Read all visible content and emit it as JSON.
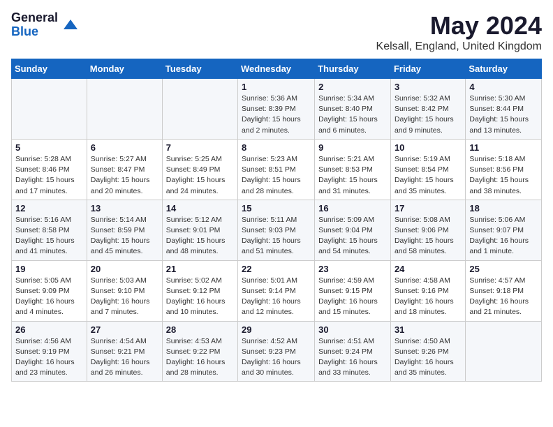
{
  "logo": {
    "general": "General",
    "blue": "Blue"
  },
  "header": {
    "month": "May 2024",
    "location": "Kelsall, England, United Kingdom"
  },
  "weekdays": [
    "Sunday",
    "Monday",
    "Tuesday",
    "Wednesday",
    "Thursday",
    "Friday",
    "Saturday"
  ],
  "weeks": [
    [
      {
        "day": "",
        "info": ""
      },
      {
        "day": "",
        "info": ""
      },
      {
        "day": "",
        "info": ""
      },
      {
        "day": "1",
        "info": "Sunrise: 5:36 AM\nSunset: 8:39 PM\nDaylight: 15 hours\nand 2 minutes."
      },
      {
        "day": "2",
        "info": "Sunrise: 5:34 AM\nSunset: 8:40 PM\nDaylight: 15 hours\nand 6 minutes."
      },
      {
        "day": "3",
        "info": "Sunrise: 5:32 AM\nSunset: 8:42 PM\nDaylight: 15 hours\nand 9 minutes."
      },
      {
        "day": "4",
        "info": "Sunrise: 5:30 AM\nSunset: 8:44 PM\nDaylight: 15 hours\nand 13 minutes."
      }
    ],
    [
      {
        "day": "5",
        "info": "Sunrise: 5:28 AM\nSunset: 8:46 PM\nDaylight: 15 hours\nand 17 minutes."
      },
      {
        "day": "6",
        "info": "Sunrise: 5:27 AM\nSunset: 8:47 PM\nDaylight: 15 hours\nand 20 minutes."
      },
      {
        "day": "7",
        "info": "Sunrise: 5:25 AM\nSunset: 8:49 PM\nDaylight: 15 hours\nand 24 minutes."
      },
      {
        "day": "8",
        "info": "Sunrise: 5:23 AM\nSunset: 8:51 PM\nDaylight: 15 hours\nand 28 minutes."
      },
      {
        "day": "9",
        "info": "Sunrise: 5:21 AM\nSunset: 8:53 PM\nDaylight: 15 hours\nand 31 minutes."
      },
      {
        "day": "10",
        "info": "Sunrise: 5:19 AM\nSunset: 8:54 PM\nDaylight: 15 hours\nand 35 minutes."
      },
      {
        "day": "11",
        "info": "Sunrise: 5:18 AM\nSunset: 8:56 PM\nDaylight: 15 hours\nand 38 minutes."
      }
    ],
    [
      {
        "day": "12",
        "info": "Sunrise: 5:16 AM\nSunset: 8:58 PM\nDaylight: 15 hours\nand 41 minutes."
      },
      {
        "day": "13",
        "info": "Sunrise: 5:14 AM\nSunset: 8:59 PM\nDaylight: 15 hours\nand 45 minutes."
      },
      {
        "day": "14",
        "info": "Sunrise: 5:12 AM\nSunset: 9:01 PM\nDaylight: 15 hours\nand 48 minutes."
      },
      {
        "day": "15",
        "info": "Sunrise: 5:11 AM\nSunset: 9:03 PM\nDaylight: 15 hours\nand 51 minutes."
      },
      {
        "day": "16",
        "info": "Sunrise: 5:09 AM\nSunset: 9:04 PM\nDaylight: 15 hours\nand 54 minutes."
      },
      {
        "day": "17",
        "info": "Sunrise: 5:08 AM\nSunset: 9:06 PM\nDaylight: 15 hours\nand 58 minutes."
      },
      {
        "day": "18",
        "info": "Sunrise: 5:06 AM\nSunset: 9:07 PM\nDaylight: 16 hours\nand 1 minute."
      }
    ],
    [
      {
        "day": "19",
        "info": "Sunrise: 5:05 AM\nSunset: 9:09 PM\nDaylight: 16 hours\nand 4 minutes."
      },
      {
        "day": "20",
        "info": "Sunrise: 5:03 AM\nSunset: 9:10 PM\nDaylight: 16 hours\nand 7 minutes."
      },
      {
        "day": "21",
        "info": "Sunrise: 5:02 AM\nSunset: 9:12 PM\nDaylight: 16 hours\nand 10 minutes."
      },
      {
        "day": "22",
        "info": "Sunrise: 5:01 AM\nSunset: 9:14 PM\nDaylight: 16 hours\nand 12 minutes."
      },
      {
        "day": "23",
        "info": "Sunrise: 4:59 AM\nSunset: 9:15 PM\nDaylight: 16 hours\nand 15 minutes."
      },
      {
        "day": "24",
        "info": "Sunrise: 4:58 AM\nSunset: 9:16 PM\nDaylight: 16 hours\nand 18 minutes."
      },
      {
        "day": "25",
        "info": "Sunrise: 4:57 AM\nSunset: 9:18 PM\nDaylight: 16 hours\nand 21 minutes."
      }
    ],
    [
      {
        "day": "26",
        "info": "Sunrise: 4:56 AM\nSunset: 9:19 PM\nDaylight: 16 hours\nand 23 minutes."
      },
      {
        "day": "27",
        "info": "Sunrise: 4:54 AM\nSunset: 9:21 PM\nDaylight: 16 hours\nand 26 minutes."
      },
      {
        "day": "28",
        "info": "Sunrise: 4:53 AM\nSunset: 9:22 PM\nDaylight: 16 hours\nand 28 minutes."
      },
      {
        "day": "29",
        "info": "Sunrise: 4:52 AM\nSunset: 9:23 PM\nDaylight: 16 hours\nand 30 minutes."
      },
      {
        "day": "30",
        "info": "Sunrise: 4:51 AM\nSunset: 9:24 PM\nDaylight: 16 hours\nand 33 minutes."
      },
      {
        "day": "31",
        "info": "Sunrise: 4:50 AM\nSunset: 9:26 PM\nDaylight: 16 hours\nand 35 minutes."
      },
      {
        "day": "",
        "info": ""
      }
    ]
  ]
}
